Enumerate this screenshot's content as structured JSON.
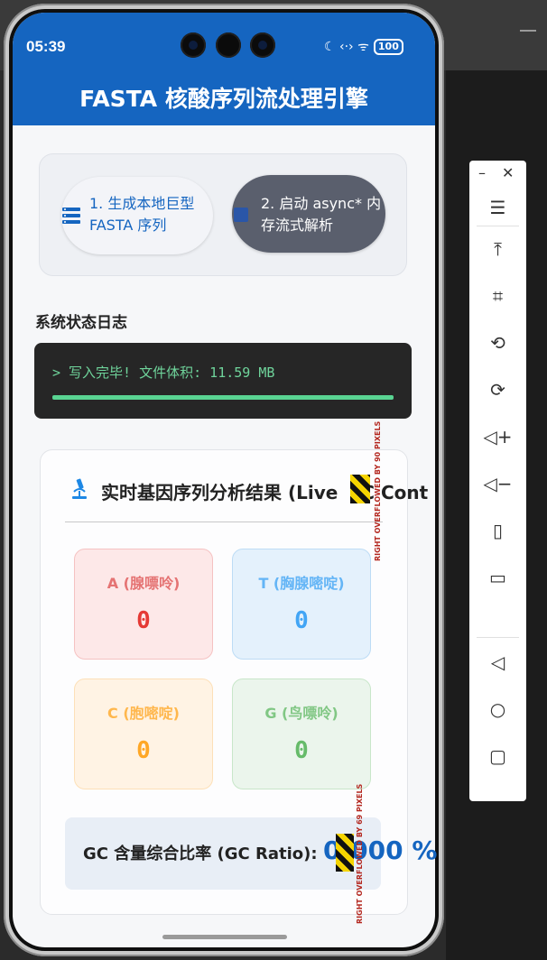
{
  "status_bar": {
    "time": "05:39",
    "icons": "☾ ‹·› ᯤ",
    "battery": "100"
  },
  "app_bar": {
    "title": "FASTA 核酸序列流处理引擎"
  },
  "buttons": {
    "generate_line1": "1. 生成本地巨型",
    "generate_line2": "FASTA 序列",
    "parse_line1": "2. 启动 async* 内",
    "parse_line2": "存流式解析"
  },
  "log": {
    "title": "系统状态日志",
    "message": "> 写入完毕! 文件体积: 11.59 MB",
    "progress": 1.0
  },
  "analysis": {
    "title": "实时基因序列分析结果 (Live",
    "title_tail": "C Cont",
    "tiles": [
      {
        "label": "A (腺嘌呤)",
        "value": "0"
      },
      {
        "label": "T (胸腺嘧啶)",
        "value": "0"
      },
      {
        "label": "C (胞嘧啶)",
        "value": "0"
      },
      {
        "label": "G (鸟嘌呤)",
        "value": "0"
      }
    ],
    "gc_label": "GC 含量综合比率 (GC Ratio):",
    "gc_value_lead": "0",
    "gc_value": ".000 %"
  },
  "overflow_notes": {
    "title": "RIGHT OVERFLOWED BY 90 PIXELS",
    "gc": "RIGHT OVERFLOWED BY 69 PIXELS"
  },
  "colors": {
    "app_bar": "#1565c0",
    "a": "#e53935",
    "t": "#42a5f5",
    "c": "#ffa726",
    "g": "#66bb6a"
  },
  "toolbar": {
    "icons": [
      "minimize-icon",
      "close-icon",
      "menu-icon",
      "pin-top-icon",
      "crop-icon",
      "rotate-icon",
      "rotate-alt-icon",
      "volume-up-icon",
      "volume-down-icon",
      "shake-icon",
      "screenshot-icon",
      "back-icon",
      "home-icon",
      "recents-icon"
    ]
  }
}
